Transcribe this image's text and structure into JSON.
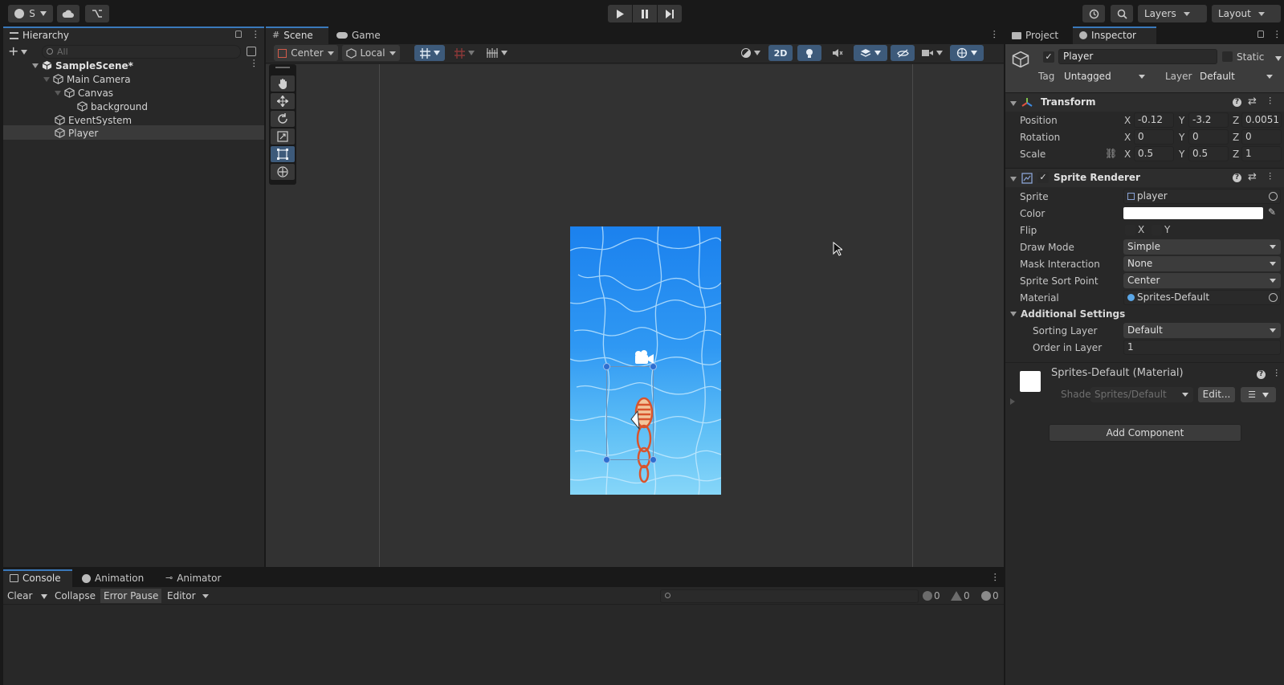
{
  "topbar": {
    "account_label": "S",
    "layers_label": "Layers",
    "layout_label": "Layout"
  },
  "hierarchy": {
    "tab_label": "Hierarchy",
    "search_placeholder": "All",
    "scene_name": "SampleScene*",
    "items": [
      {
        "label": "Main Camera"
      },
      {
        "label": "Canvas"
      },
      {
        "label": "background"
      },
      {
        "label": "EventSystem"
      },
      {
        "label": "Player"
      }
    ]
  },
  "scene": {
    "tabs": [
      {
        "label": "Scene"
      },
      {
        "label": "Game"
      }
    ],
    "pivot_label": "Center",
    "space_label": "Local",
    "mode_2d_label": "2D"
  },
  "inspector": {
    "tabs": [
      {
        "label": "Project"
      },
      {
        "label": "Inspector"
      }
    ],
    "object_name": "Player",
    "static_label": "Static",
    "tag_label": "Tag",
    "tag_value": "Untagged",
    "layer_label": "Layer",
    "layer_value": "Default",
    "transform": {
      "title": "Transform",
      "position_label": "Position",
      "rotation_label": "Rotation",
      "scale_label": "Scale",
      "axis_x": "X",
      "axis_y": "Y",
      "axis_z": "Z",
      "position": {
        "x": "-0.12",
        "y": "-3.2",
        "z": "0.0051"
      },
      "rotation": {
        "x": "0",
        "y": "0",
        "z": "0"
      },
      "scale": {
        "x": "0.5",
        "y": "0.5",
        "z": "1"
      }
    },
    "sprite_renderer": {
      "title": "Sprite Renderer",
      "sprite_label": "Sprite",
      "sprite_value": "player",
      "color_label": "Color",
      "color_value": "#ffffff",
      "flip_label": "Flip",
      "flip_x": "X",
      "flip_y": "Y",
      "draw_mode_label": "Draw Mode",
      "draw_mode_value": "Simple",
      "mask_label": "Mask Interaction",
      "mask_value": "None",
      "sort_point_label": "Sprite Sort Point",
      "sort_point_value": "Center",
      "material_label": "Material",
      "material_value": "Sprites-Default",
      "additional_label": "Additional Settings",
      "sorting_layer_label": "Sorting Layer",
      "sorting_layer_value": "Default",
      "order_label": "Order in Layer",
      "order_value": "1"
    },
    "material": {
      "title": "Sprites-Default (Material)",
      "shader_label": "Shader",
      "shader_value": "Sprites/Default",
      "edit_label": "Edit..."
    },
    "add_component_label": "Add Component"
  },
  "console": {
    "tabs": [
      {
        "label": "Console"
      },
      {
        "label": "Animation"
      },
      {
        "label": "Animator"
      }
    ],
    "clear_label": "Clear",
    "collapse_label": "Collapse",
    "error_pause_label": "Error Pause",
    "editor_label": "Editor",
    "log_count": "0",
    "warn_count": "0",
    "error_count": "0"
  },
  "colors": {
    "accent": "#3a79bb",
    "selection": "#2c5d87",
    "background_water_top": "#1f86f0",
    "background_water_bottom": "#7fd2f7"
  }
}
